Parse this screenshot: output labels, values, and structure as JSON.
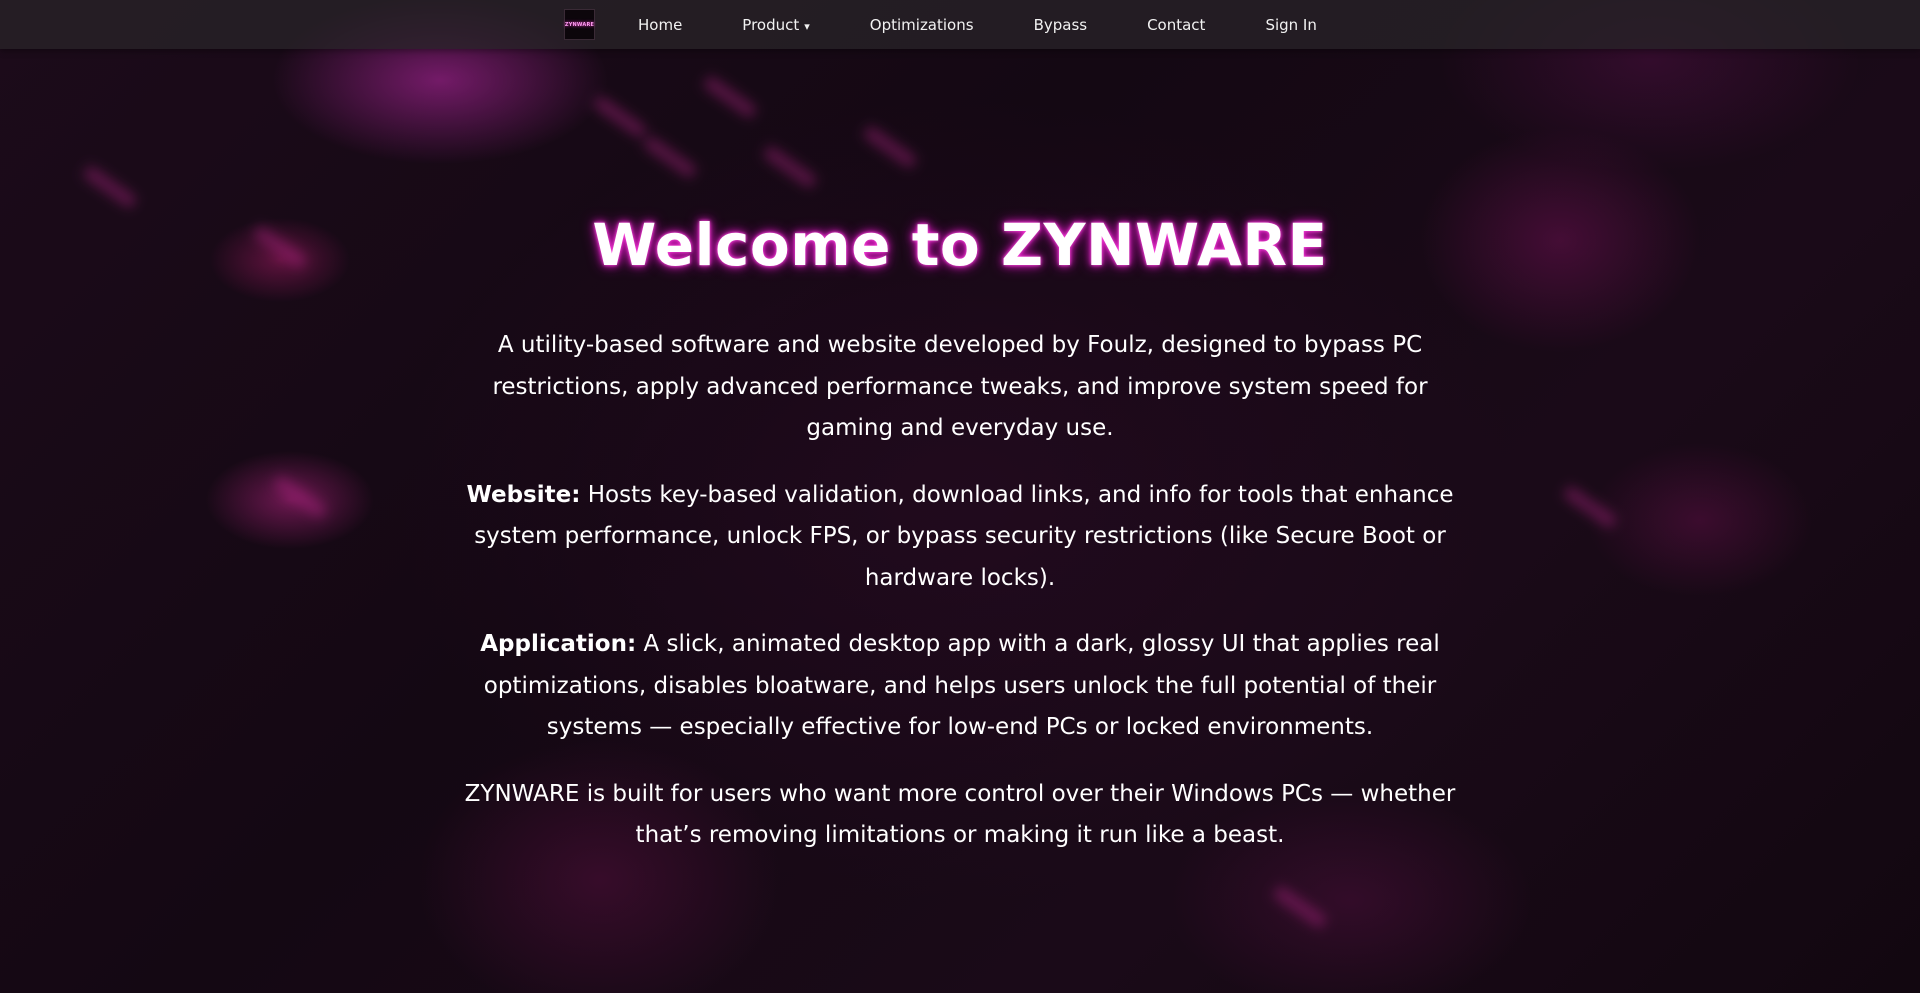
{
  "brand": {
    "logo_text": "ZYNWARE"
  },
  "nav": {
    "items": [
      {
        "label": "Home"
      },
      {
        "label": "Product",
        "caret": "▾"
      },
      {
        "label": "Optimizations"
      },
      {
        "label": "Bypass"
      },
      {
        "label": "Contact"
      },
      {
        "label": "Sign In"
      }
    ]
  },
  "hero": {
    "title": "Welcome to ZYNWARE",
    "intro": "A utility-based software and website developed by Foulz, designed to bypass PC restrictions, apply advanced performance tweaks, and improve system speed for gaming and everyday use.",
    "website_label": "Website:",
    "website_text": " Hosts key-based validation, download links, and info for tools that enhance system performance, unlock FPS, or bypass security restrictions (like Secure Boot or hardware locks).",
    "application_label": "Application:",
    "application_text": " A slick, animated desktop app with a dark, glossy UI that applies real optimizations, disables bloatware, and helps users unlock the full potential of their systems — especially effective for low-end PCs or locked environments.",
    "closing": "ZYNWARE is built for users who want more control over their Windows PCs — whether that’s removing limitations or making it run like a beast."
  },
  "colors": {
    "accent_glow": "#e21cc4",
    "background": "#120810",
    "navbar": "#282228"
  }
}
